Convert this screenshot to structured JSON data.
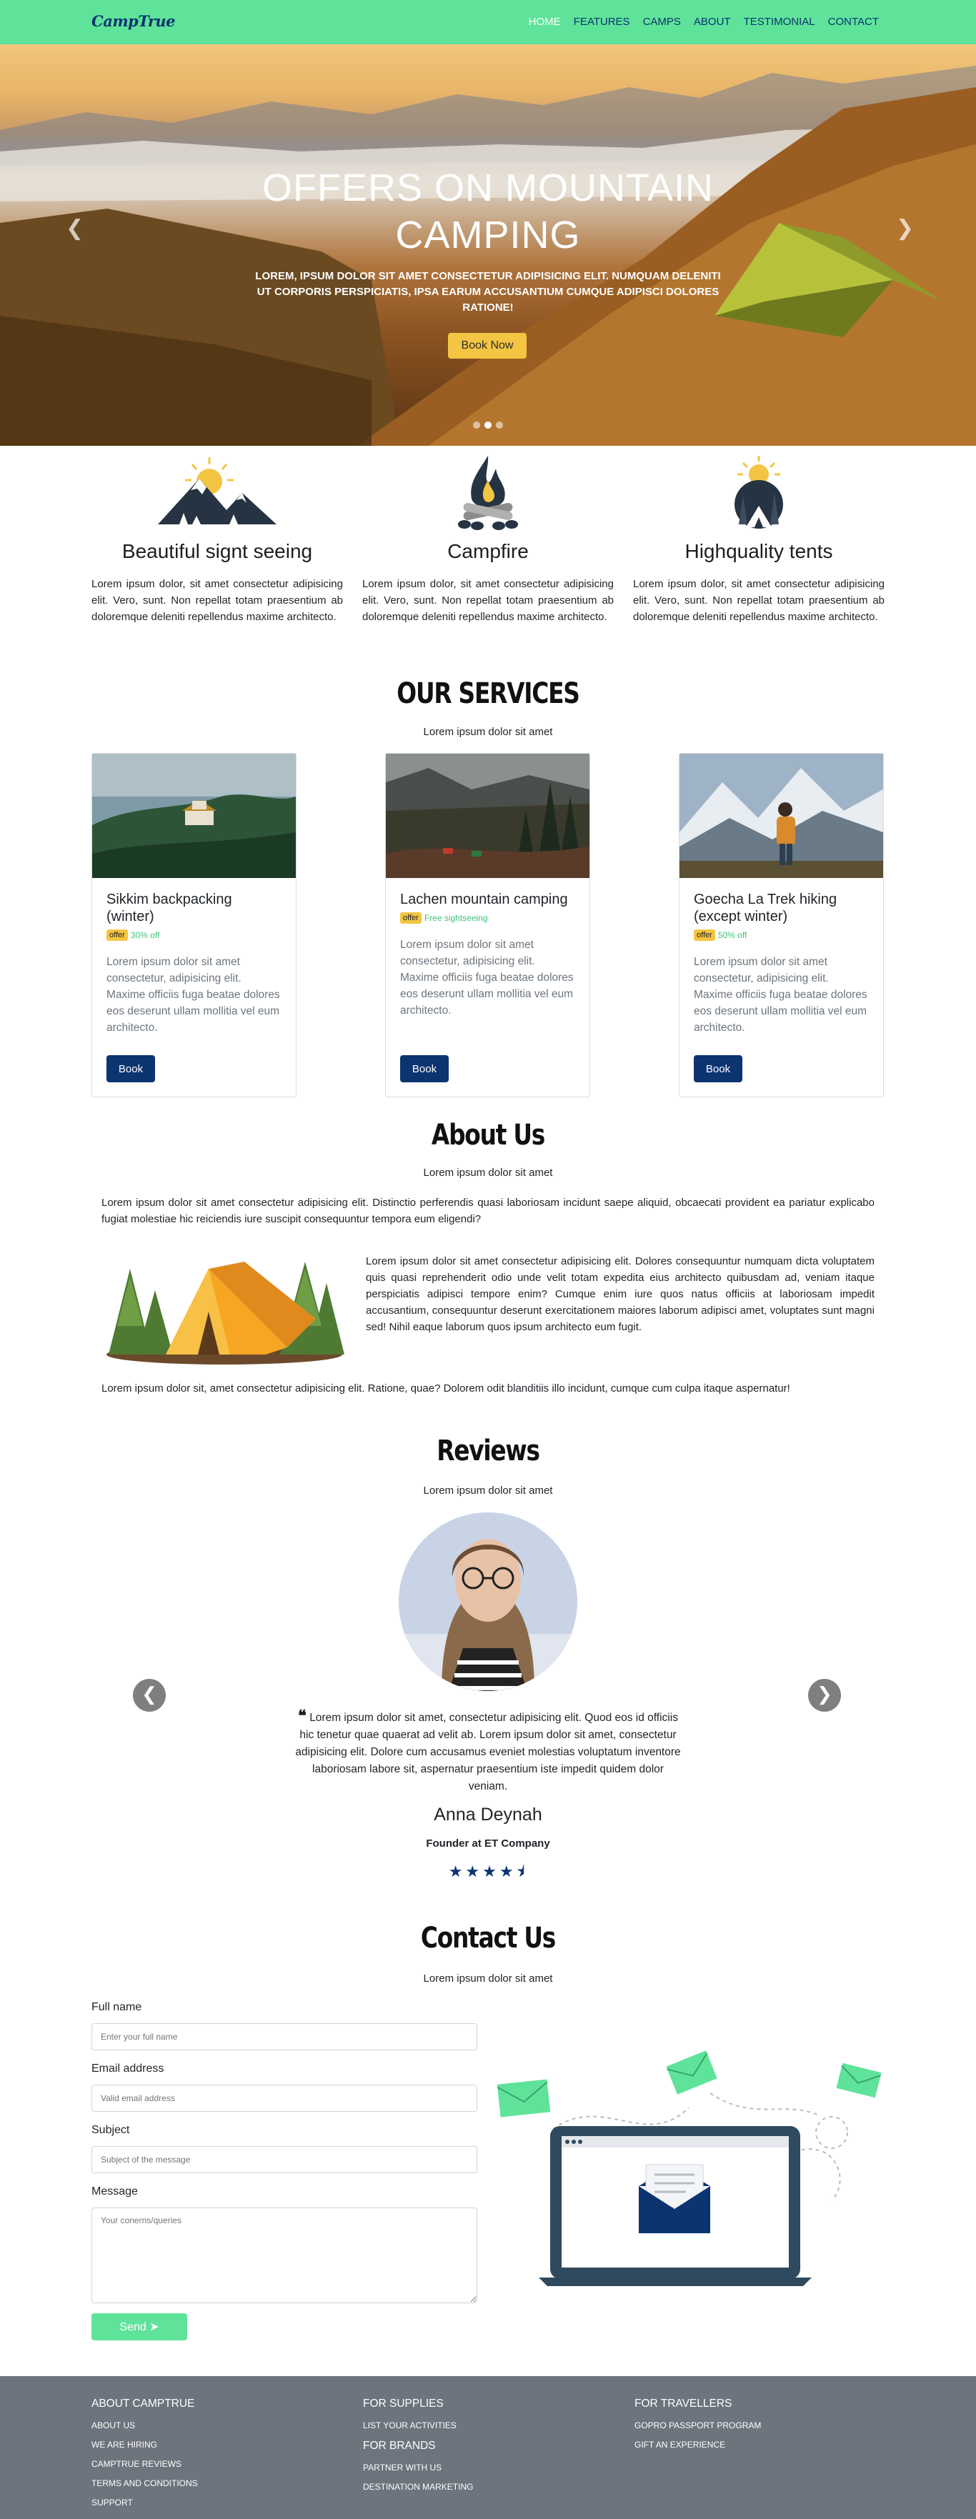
{
  "nav": {
    "brand": "CampTrue",
    "links": [
      "HOME",
      "FEATURES",
      "CAMPS",
      "ABOUT",
      "TESTIMONIAL",
      "CONTACT"
    ]
  },
  "hero": {
    "title": "OFFERS ON MOUNTAIN CAMPING",
    "subtitle": "LOREM, IPSUM DOLOR SIT AMET CONSECTETUR ADIPISICING ELIT. NUMQUAM DELENITI UT CORPORIS PERSPICIATIS, IPSA EARUM ACCUSANTIUM CUMQUE ADIPISCI DOLORES RATIONE!",
    "button": "Book Now",
    "prev_icon": "chevron-left-icon",
    "next_icon": "chevron-right-icon",
    "slides": 3,
    "active_slide": 2
  },
  "features": [
    {
      "title": "Beautiful signt seeing",
      "icon": "mountain-sun-icon",
      "text": "Lorem ipsum dolor, sit amet consectetur adipisicing elit. Vero, sunt. Non repellat totam praesentium ab doloremque deleniti repellendus maxime architecto."
    },
    {
      "title": "Campfire",
      "icon": "campfire-icon",
      "text": "Lorem ipsum dolor, sit amet consectetur adipisicing elit. Vero, sunt. Non repellat totam praesentium ab doloremque deleniti repellendus maxime architecto."
    },
    {
      "title": "Highquality tents",
      "icon": "tent-sun-icon",
      "text": "Lorem ipsum dolor, sit amet consectetur adipisicing elit. Vero, sunt. Non repellat totam praesentium ab doloremque deleniti repellendus maxime architecto."
    }
  ],
  "services": {
    "title": "OUR SERVICES",
    "subtitle": "Lorem ipsum dolor sit amet",
    "cards": [
      {
        "title": "Sikkim backpacking (winter)",
        "badge": "offer",
        "offer": "30% off",
        "text": "Lorem ipsum dolor sit amet consectetur, adipisicing elit. Maxime officiis fuga beatae dolores eos deserunt ullam mollitia vel eum architecto.",
        "button": "Book"
      },
      {
        "title": "Lachen mountain camping",
        "badge": "offer",
        "offer": "Free sightseeing",
        "text": "Lorem ipsum dolor sit amet consectetur, adipisicing elit. Maxime officiis fuga beatae dolores eos deserunt ullam mollitia vel eum architecto.",
        "button": "Book"
      },
      {
        "title": "Goecha La Trek hiking (except winter)",
        "badge": "offer",
        "offer": "50% off",
        "text": "Lorem ipsum dolor sit amet consectetur, adipisicing elit. Maxime officiis fuga beatae dolores eos deserunt ullam mollitia vel eum architecto.",
        "button": "Book"
      }
    ]
  },
  "about": {
    "title": "About Us",
    "subtitle": "Lorem ipsum dolor sit amet",
    "p1": "Lorem ipsum dolor sit amet consectetur adipisicing elit. Distinctio perferendis quasi laboriosam incidunt saepe aliquid, obcaecati provident ea pariatur explicabo fugiat molestiae hic reiciendis iure suscipit consequuntur tempora eum eligendi?",
    "p2": "Lorem ipsum dolor sit amet consectetur adipisicing elit. Dolores consequuntur numquam dicta voluptatem quis quasi reprehenderit odio unde velit totam expedita eius architecto quibusdam ad, veniam itaque perspiciatis adipisci tempore enim? Cumque enim iure quos natus officiis at laboriosam impedit accusantium, consequuntur deserunt exercitationem maiores laborum adipisci amet, voluptates sunt magni sed! Nihil eaque laborum quos ipsum architecto eum fugit.",
    "p3": "Lorem ipsum dolor sit, amet consectetur adipisicing elit. Ratione, quae? Dolorem odit blanditiis illo incidunt, cumque cum culpa itaque aspernatur!"
  },
  "reviews": {
    "title": "Reviews",
    "subtitle": "Lorem ipsum dolor sit amet",
    "quote": "Lorem ipsum dolor sit amet, consectetur adipisicing elit. Quod eos id officiis hic tenetur quae quaerat ad velit ab. Lorem ipsum dolor sit amet, consectetur adipisicing elit. Dolore cum accusamus eveniet molestias voluptatum inventore laboriosam labore sit, aspernatur praesentium iste impedit quidem dolor veniam.",
    "name": "Anna Deynah",
    "role": "Founder at ET Company",
    "rating": 4.5,
    "prev_icon": "arrow-left-circle-icon",
    "next_icon": "arrow-right-circle-icon"
  },
  "contact": {
    "title": "Contact Us",
    "subtitle": "Lorem ipsum dolor sit amet",
    "name_label": "Full name",
    "name_placeholder": "Enter your full name",
    "email_label": "Email address",
    "email_placeholder": "Valid email address",
    "subject_label": "Subject",
    "subject_placeholder": "Subject of the message",
    "message_label": "Message",
    "message_placeholder": "Your conerns/queries",
    "send": "Send",
    "send_icon": "paper-plane-icon"
  },
  "footer": {
    "col1_head": "ABOUT CAMPTRUE",
    "col1_links": [
      "ABOUT US",
      "WE ARE HIRING",
      "CAMPTRUE REVIEWS",
      "TERMS AND CONDITIONS",
      "SUPPORT"
    ],
    "col2_head": "FOR SUPPLIES",
    "col2_links": [
      "LIST YOUR ACTIVITIES"
    ],
    "col2b_head": "FOR BRANDS",
    "col2b_links": [
      "PARTNER WITH US",
      "DESTINATION MARKETING"
    ],
    "col3_head": "FOR TRAVELLERS",
    "col3_links": [
      "GOPRO PASSPORT PROGRAM",
      "GIFT AN EXPERIENCE"
    ]
  },
  "colors": {
    "nav_bg": "#5fe39a",
    "brand_navy": "#0b3470",
    "accent_yellow": "#f4c542",
    "offer_green": "#3ec476",
    "footer_bg": "#6c757d"
  }
}
